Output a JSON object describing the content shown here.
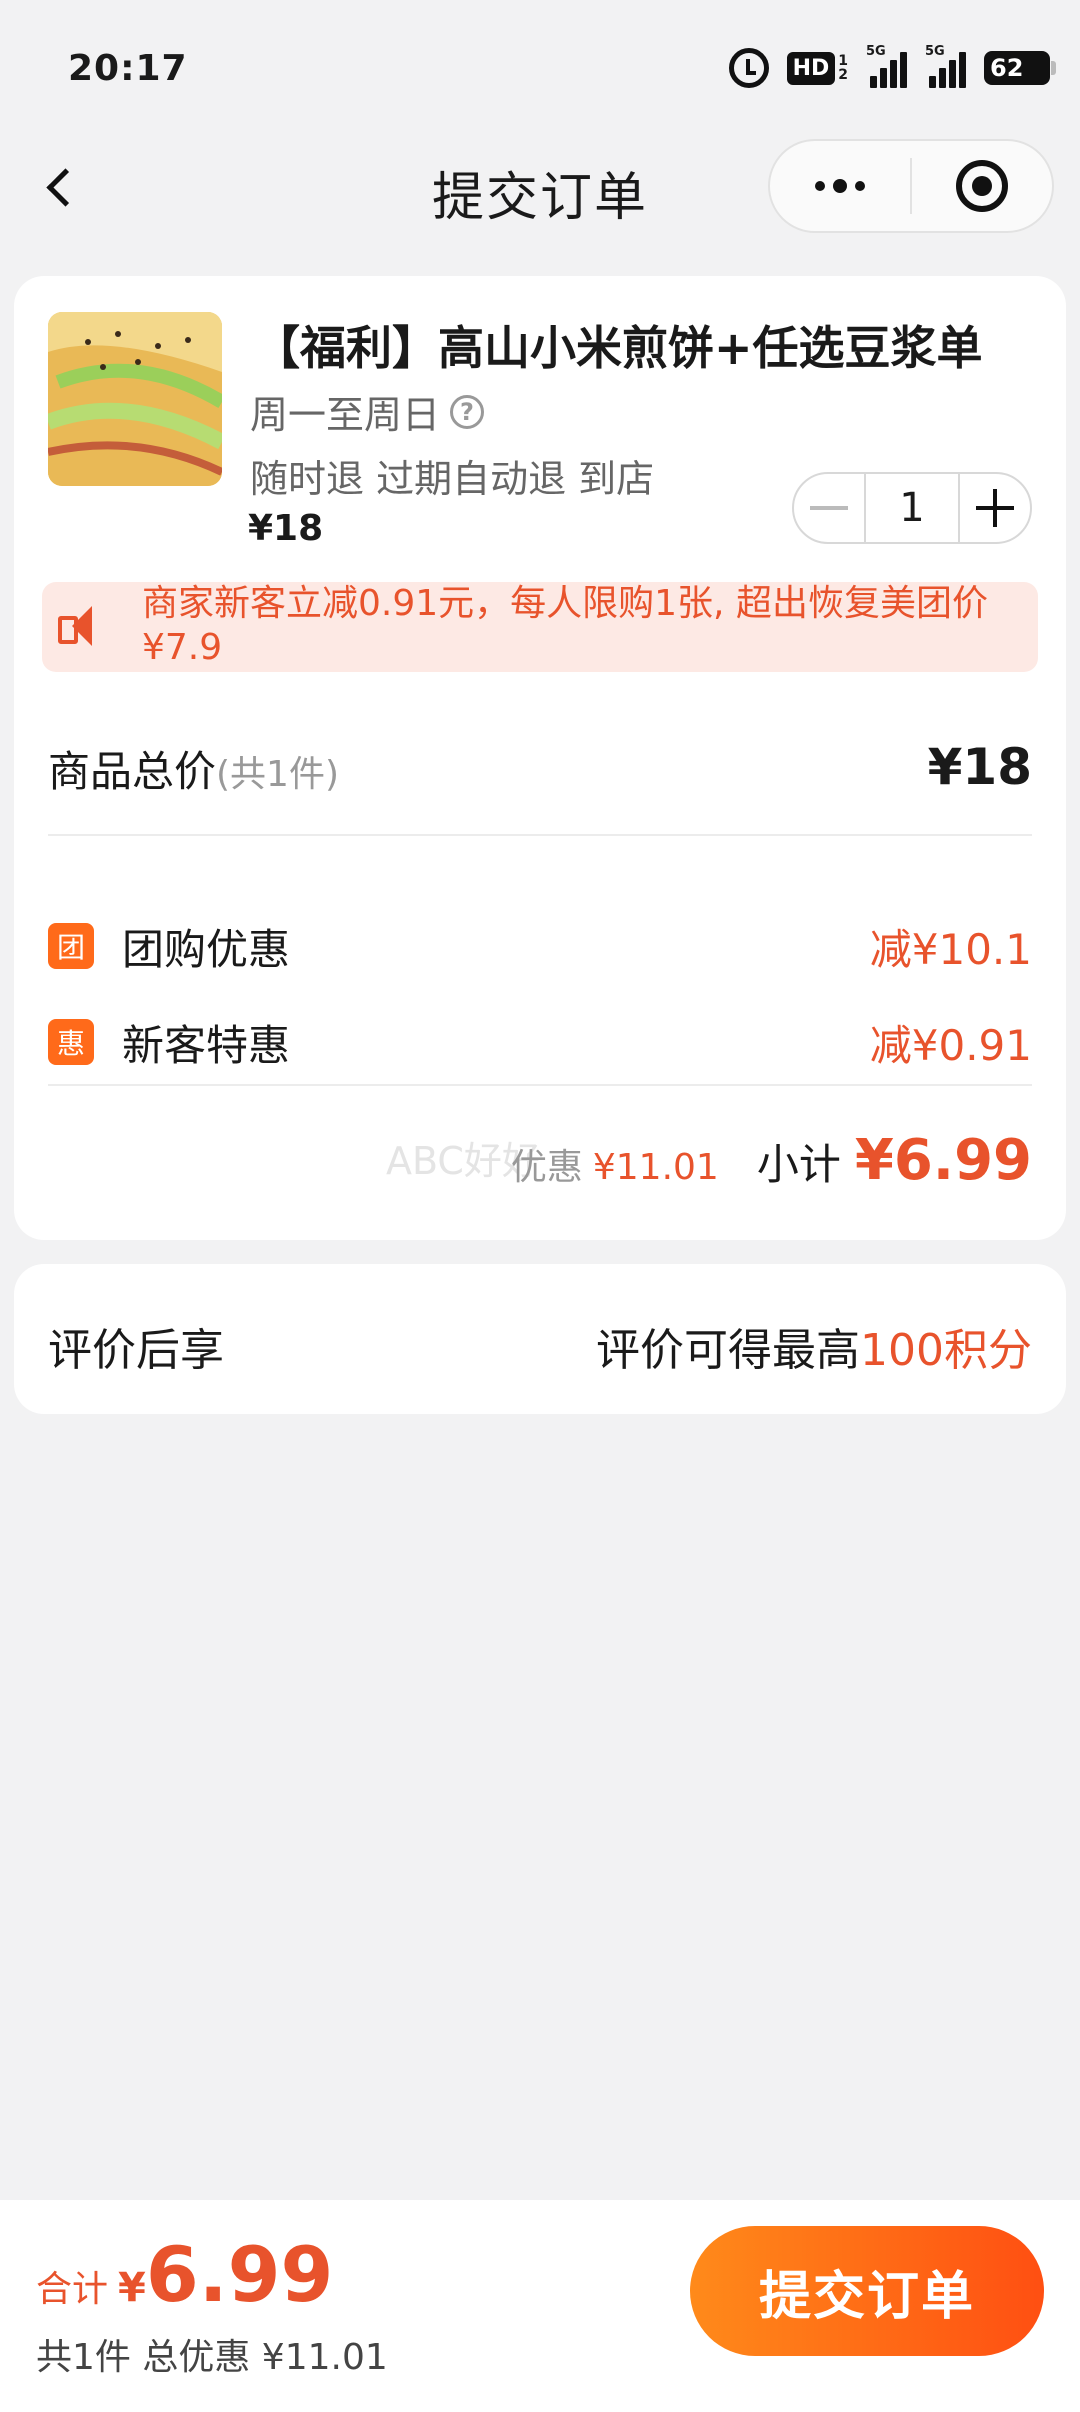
{
  "status_bar": {
    "time": "20:17",
    "hd_label": "HD",
    "hd_sub_top": "1",
    "hd_sub_bottom": "2",
    "net1": "5G",
    "net2": "5G",
    "battery": "62"
  },
  "nav": {
    "title": "提交订单",
    "icons": [
      "back-arrow-icon",
      "more-dots-icon",
      "target-icon"
    ]
  },
  "order": {
    "product_title": "【福利】高山小米煎饼+任选豆浆单",
    "days": "周一至周日",
    "help_icon_glyph": "?",
    "refund_text": "随时退 过期自动退 到店",
    "price": "¥18",
    "quantity": "1",
    "promo_text": "商家新客立减0.91元，每人限购1张, 超出恢复美团价¥7.9",
    "total_label": "商品总价",
    "total_count": "(共1件)",
    "total_value": "¥18",
    "discounts": [
      {
        "icon_text": "团",
        "label": "团购优惠",
        "value": "减¥10.1"
      },
      {
        "icon_text": "惠",
        "label": "新客特惠",
        "value": "减¥0.91"
      }
    ],
    "watermark": "ABC好好",
    "subtotal_discount_label": "优惠",
    "subtotal_discount_value": "¥11.01",
    "subtotal_label": "小计",
    "subtotal_value": "¥6.99"
  },
  "review": {
    "left_label": "评价后享",
    "right_prefix": "评价可得最高",
    "right_highlight": "100积分"
  },
  "bottom": {
    "total_label": "合计",
    "yen": "¥",
    "total_value": "6.99",
    "sub_text": "共1件 总优惠 ¥11.01",
    "submit_label": "提交订单"
  },
  "colors": {
    "accent": "#e8532c",
    "button_start": "#ff8a1a",
    "button_end": "#ff4f12",
    "promo_bg": "#fde9e4",
    "page_bg": "#f2f2f3"
  }
}
